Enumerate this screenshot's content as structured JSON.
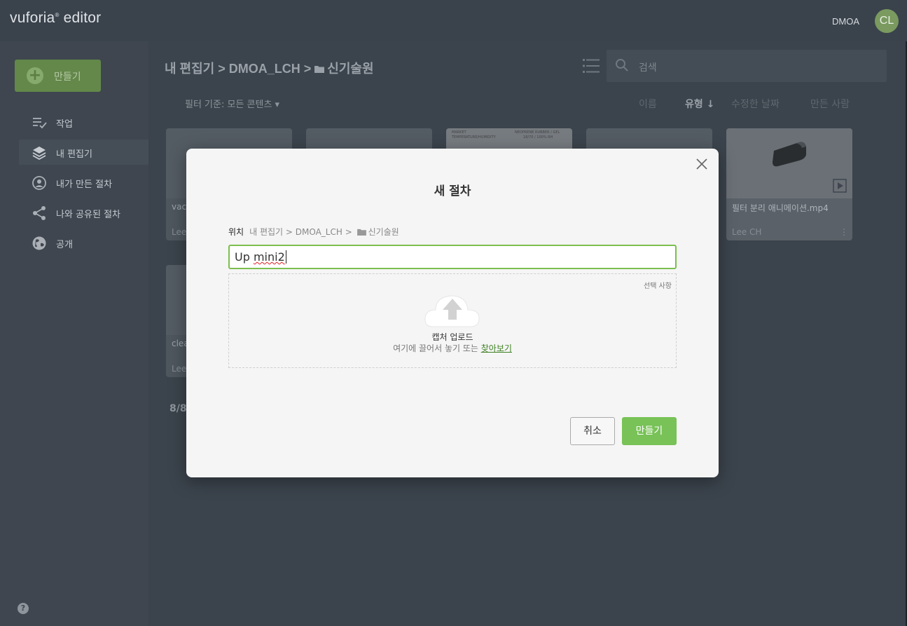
{
  "app": {
    "logo_brand": "vuforia",
    "logo_mark": "®",
    "logo_product": " editor",
    "org": "DMOA",
    "avatar_initials": "CL"
  },
  "sidebar": {
    "create_label": "만들기",
    "items": [
      {
        "label": "작업",
        "icon": "tasks-icon"
      },
      {
        "label": "내 편집기",
        "icon": "layers-icon",
        "active": true
      },
      {
        "label": "내가 만든 절차",
        "icon": "user-circle-icon"
      },
      {
        "label": "나와 공유된 절차",
        "icon": "share-icon"
      },
      {
        "label": "공개",
        "icon": "globe-icon"
      }
    ],
    "help_label": "?"
  },
  "main": {
    "breadcrumb": "내 편집기 > DMOA_LCH > ",
    "breadcrumb_folder": "신기술원",
    "search_placeholder": "검색",
    "filter_label": "필터 기준: 모든 콘텐츠 ▾",
    "sort": [
      {
        "label": "이름"
      },
      {
        "label": "유형 ↓",
        "active": true
      },
      {
        "label": "수정한 날짜"
      },
      {
        "label": "만든 사람"
      }
    ],
    "cards": [
      {
        "name": "vac",
        "owner": "Lee"
      },
      {
        "name": "",
        "owner": ""
      },
      {
        "name": "",
        "owner": ""
      },
      {
        "name": "",
        "owner": ""
      },
      {
        "name": "필터 분리 애니메이션.mp4",
        "owner": "Lee CH",
        "more": "⋮"
      },
      {
        "name": "clea",
        "owner": "Lee"
      }
    ],
    "card_doc": {
      "row1_left": "MARKET",
      "row1_right": "NEOPRENE RUBBER / GEL",
      "row2_left": "TEMPERATURE/HUMIDITY",
      "row2_right": "18/70 / 100% RH"
    },
    "count": "8/8"
  },
  "modal": {
    "title": "새 절차",
    "location_label": "위치",
    "location_path": "내 편집기 > DMOA_LCH > ",
    "location_folder": "신기술원",
    "name_value_a": "Up ",
    "name_value_b": "mini2",
    "optional_label": "선택 사항",
    "upload_title": "캡처 업로드",
    "upload_sub": "여기에 끌어서 놓기 또는 ",
    "browse_label": "찾아보기",
    "cancel_label": "취소",
    "create_label": "만들기"
  },
  "colors": {
    "accent_green": "#78c257",
    "focus_border": "#7cbf4e",
    "sidebar_bg": "#3f464f",
    "overlay_bg": "#3b434c"
  }
}
